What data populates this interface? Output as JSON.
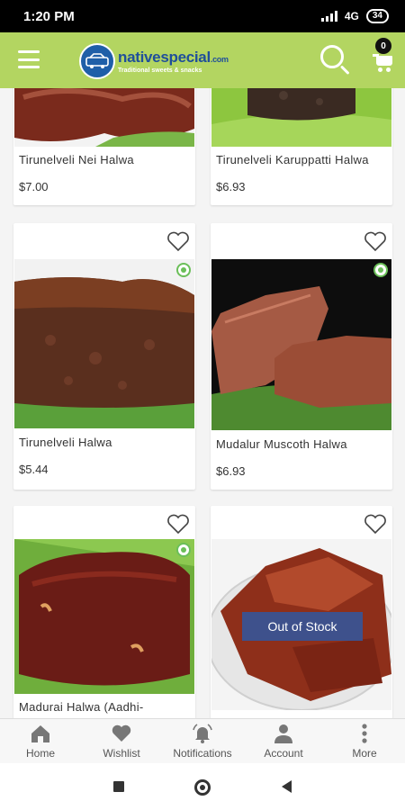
{
  "status_bar": {
    "time": "1:20 PM",
    "network": "4G",
    "battery": "34"
  },
  "header": {
    "logo_name": "nativespecial",
    "logo_domain": ".com",
    "logo_tagline": "Traditional sweets & snacks",
    "cart_count": "0",
    "accent_color": "#b3d561"
  },
  "products": [
    {
      "name": "Tirunelveli Nei Halwa",
      "price": "$7.00"
    },
    {
      "name": "Tirunelveli Karuppatti Halwa",
      "price": "$6.93"
    },
    {
      "name": "Tirunelveli Halwa",
      "price": "$5.44"
    },
    {
      "name": "Mudalur Muscoth Halwa",
      "price": "$6.93"
    },
    {
      "name": "Madurai Halwa (Aadhi-",
      "price": ""
    },
    {
      "name": "",
      "price": "",
      "badge": "Out of Stock"
    }
  ],
  "bottom_nav": [
    {
      "label": "Home",
      "icon": "home-icon"
    },
    {
      "label": "Wishlist",
      "icon": "heart-icon"
    },
    {
      "label": "Notifications",
      "icon": "bell-icon"
    },
    {
      "label": "Account",
      "icon": "person-icon"
    },
    {
      "label": "More",
      "icon": "more-vertical-icon"
    }
  ]
}
